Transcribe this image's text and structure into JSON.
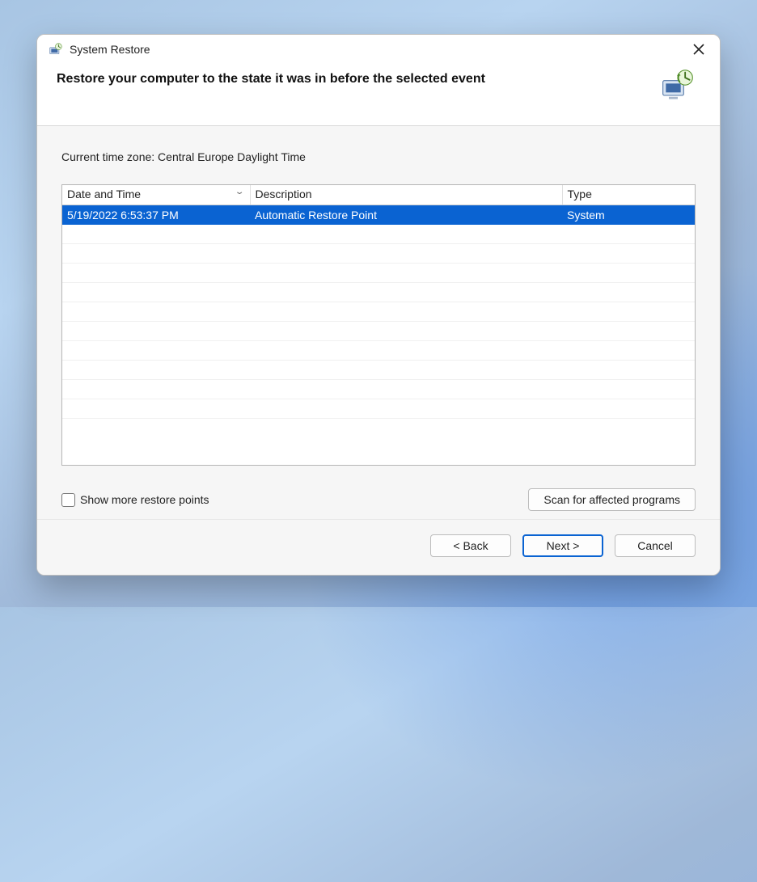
{
  "window": {
    "title": "System Restore"
  },
  "header": {
    "title": "Restore your computer to the state it was in before the selected event"
  },
  "timezone_label": "Current time zone: Central Europe Daylight Time",
  "table": {
    "columns": {
      "date": "Date and Time",
      "description": "Description",
      "type": "Type"
    },
    "rows": [
      {
        "date": "5/19/2022 6:53:37 PM",
        "description": "Automatic Restore Point",
        "type": "System",
        "selected": true
      }
    ]
  },
  "show_more": {
    "label": "Show more restore points",
    "checked": false
  },
  "scan_button": "Scan for affected programs",
  "footer": {
    "back": "< Back",
    "next": "Next >",
    "cancel": "Cancel"
  }
}
